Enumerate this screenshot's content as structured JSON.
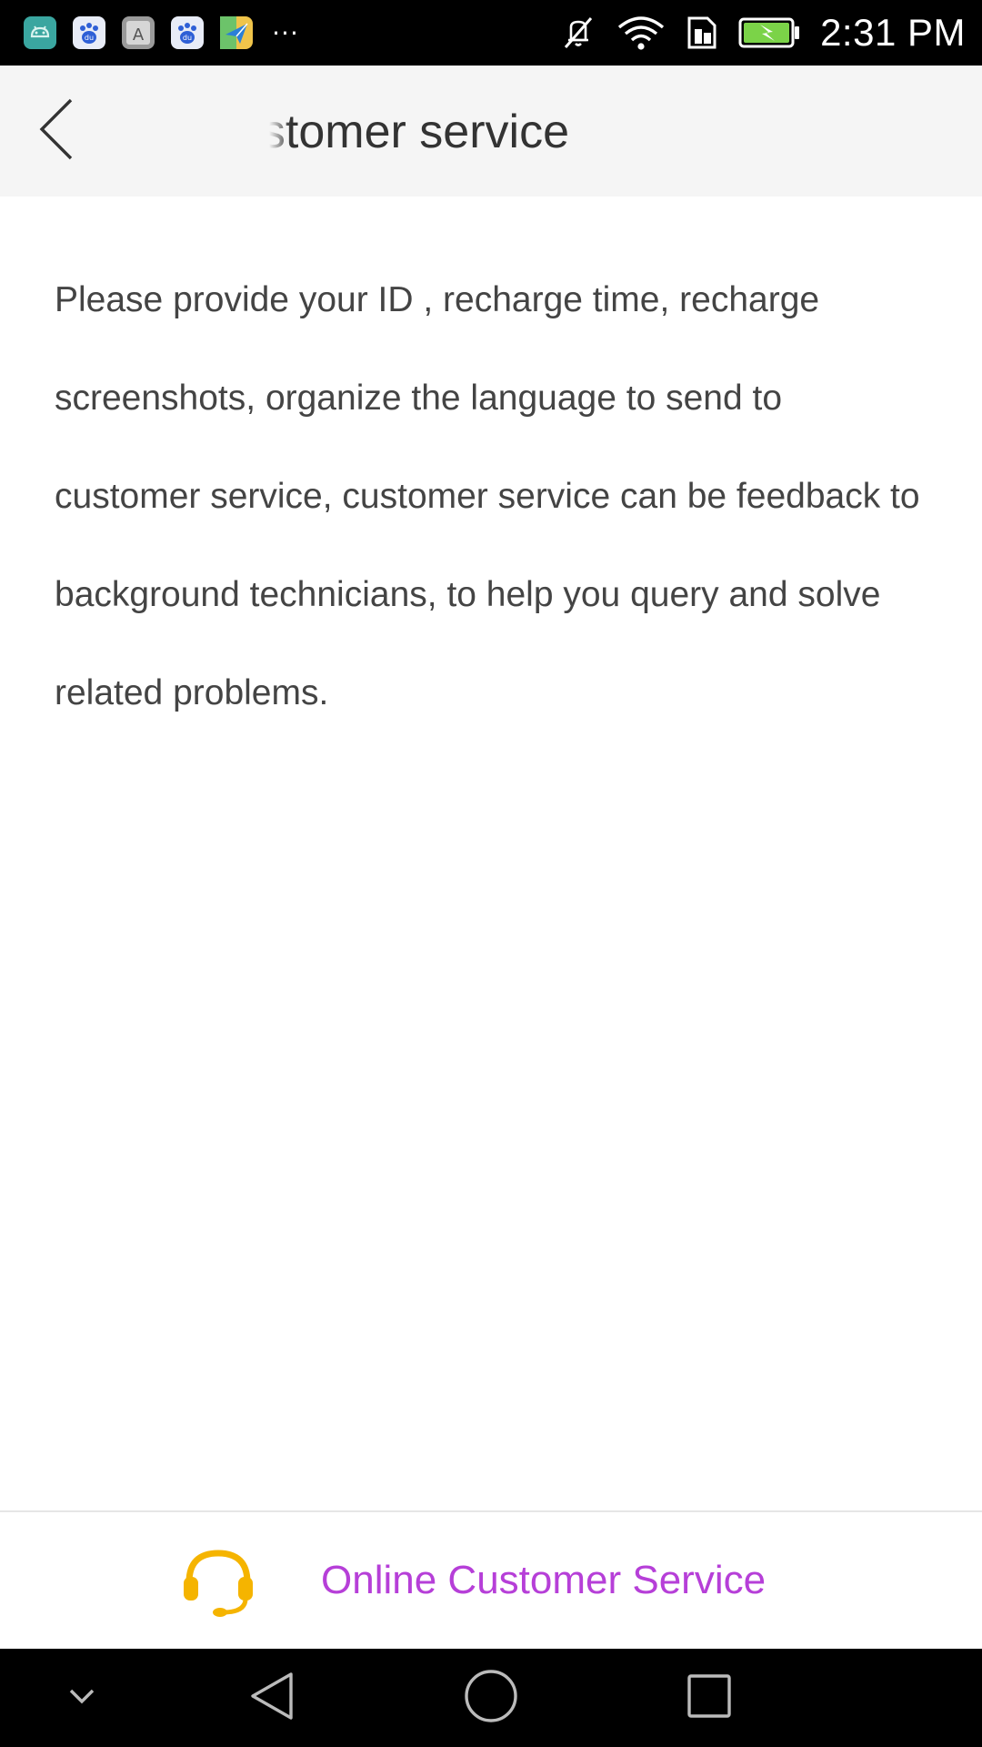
{
  "status_bar": {
    "time": "2:31 PM",
    "more_notifications": "···",
    "notification_icons": [
      "android-app-icon",
      "baidu-icon",
      "font-app-icon",
      "baidu-icon",
      "maps-send-icon"
    ],
    "status_icons": [
      "mute-icon",
      "wifi-icon",
      "sim-icon",
      "battery-charging-icon"
    ],
    "colors": {
      "background": "#000000",
      "text": "#ffffff",
      "battery": "#7bd348"
    }
  },
  "header": {
    "title": "Customer service",
    "back_icon": "chevron-left-icon",
    "background": "#f5f5f5"
  },
  "main": {
    "instructions": "Please provide your ID , recharge time, recharge screenshots, organize the language to send to customer service, customer service can be feedback to background technicians, to help you query and solve related problems."
  },
  "footer_action": {
    "label": "Online Customer Service",
    "icon": "headset-icon",
    "colors": {
      "label": "#b63fd8",
      "icon": "#f5b400"
    }
  },
  "nav_bar": {
    "buttons": [
      "hide-keyboard-icon",
      "back-triangle-icon",
      "home-circle-icon",
      "recents-square-icon"
    ]
  }
}
